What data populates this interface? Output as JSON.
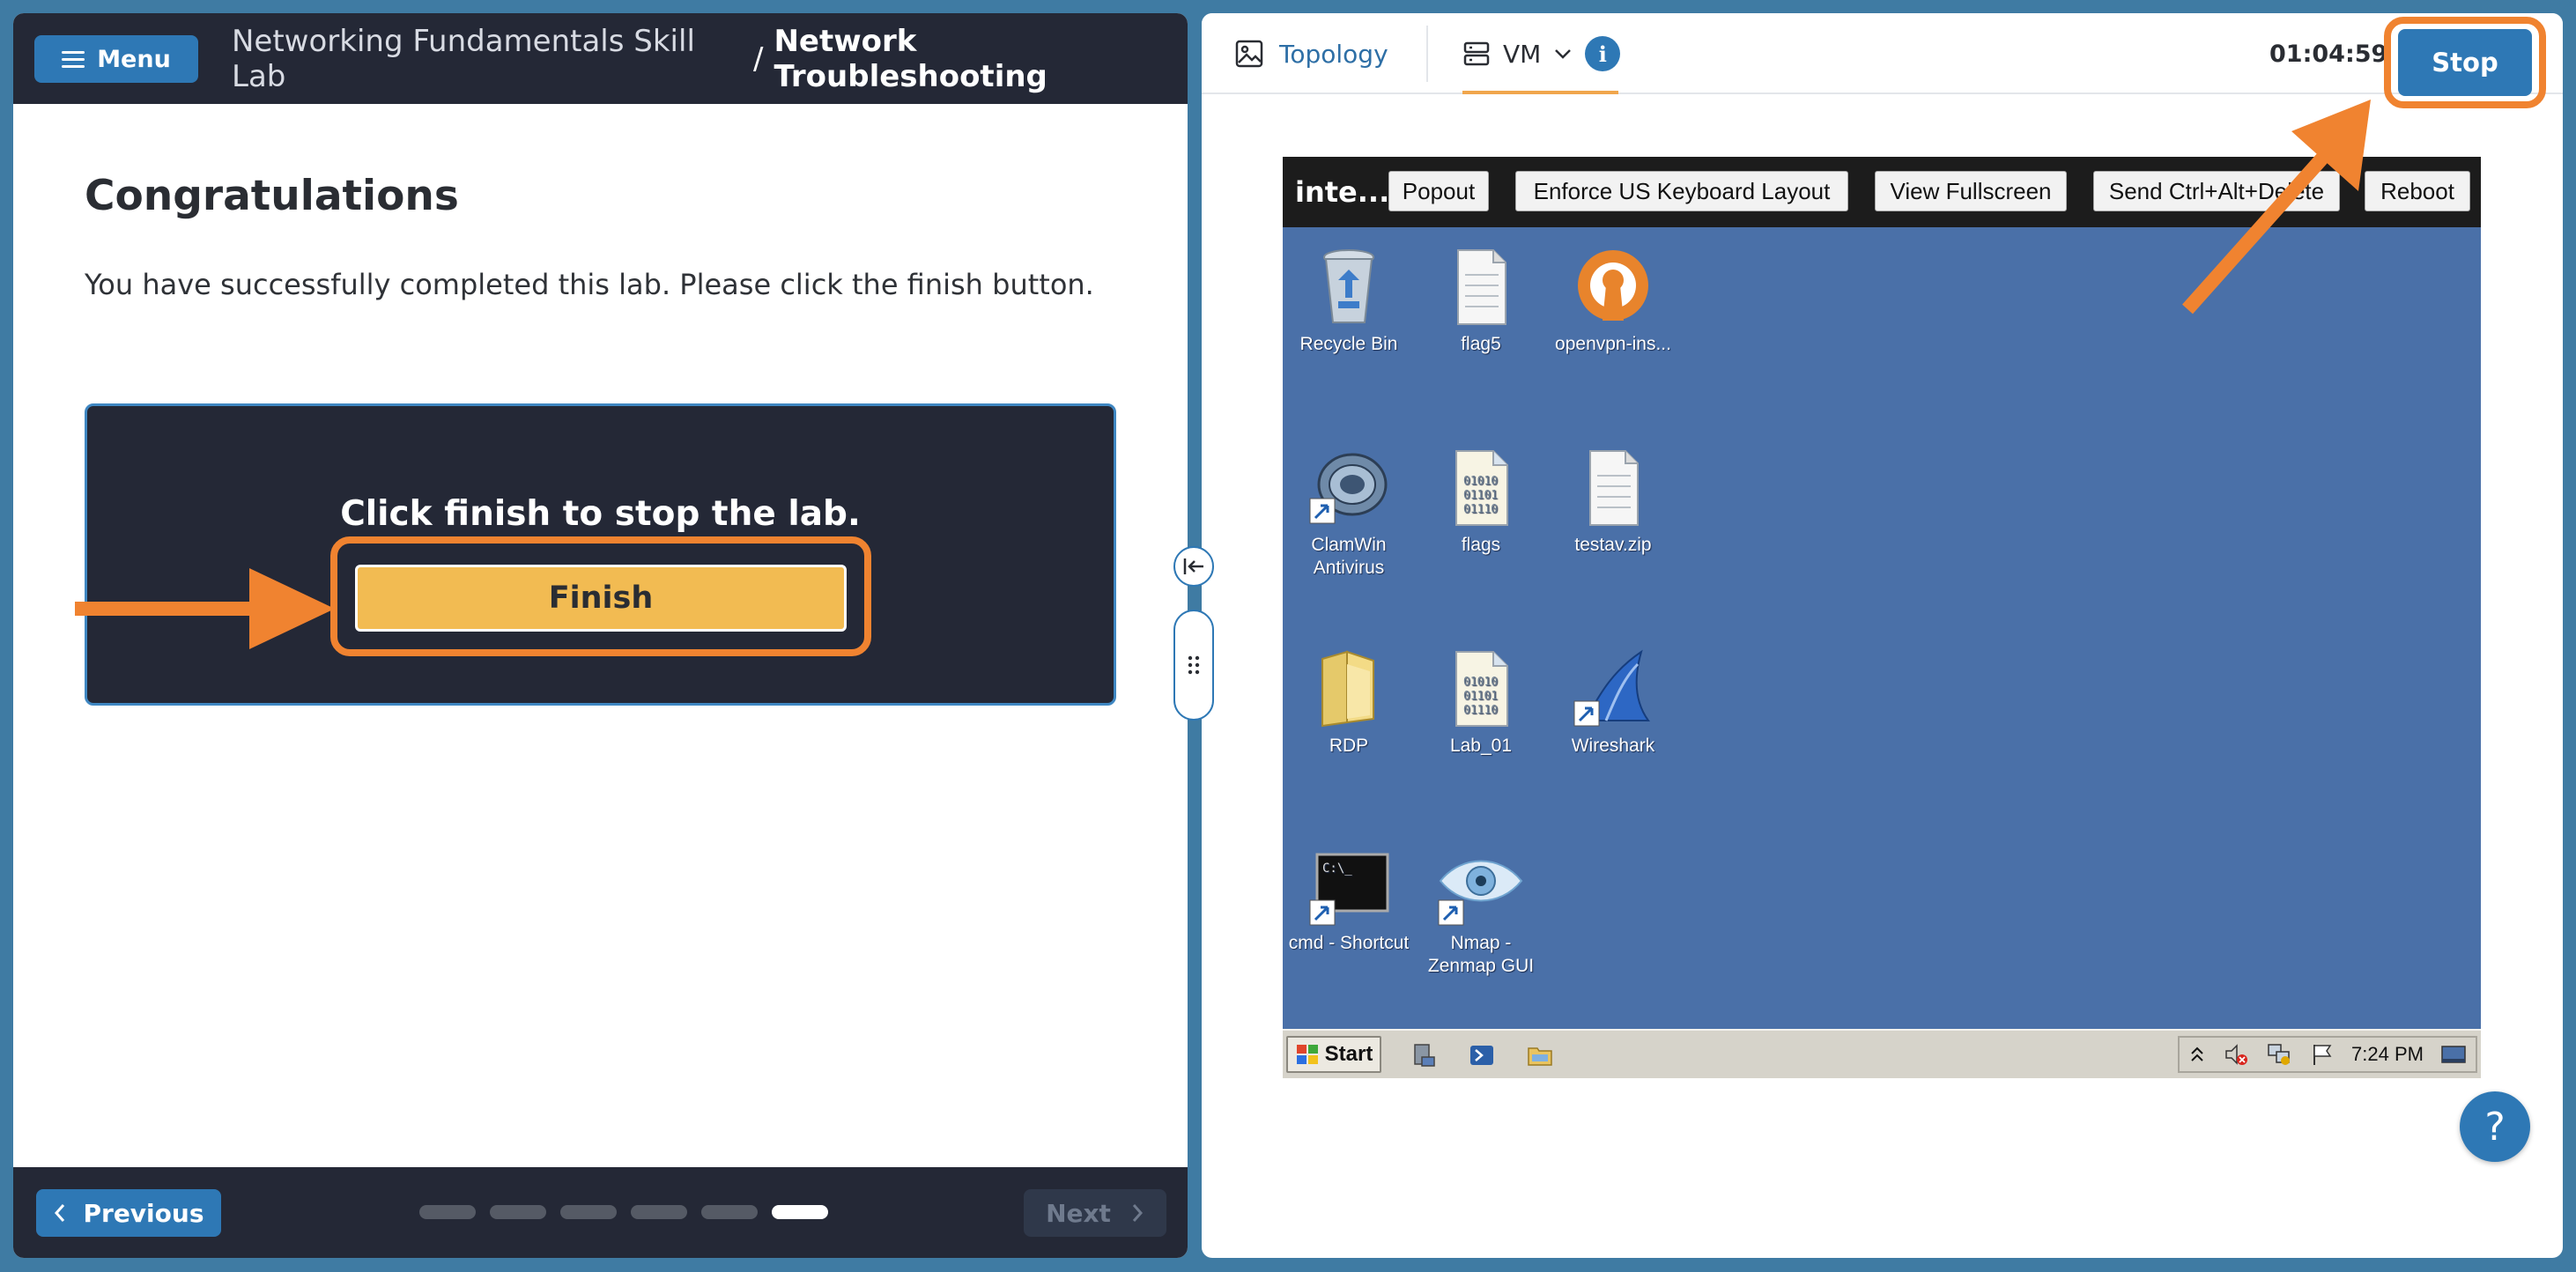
{
  "header": {
    "menu_label": "Menu",
    "course_name": "Networking Fundamentals Skill Lab",
    "separator": "/",
    "lab_name": "Network Troubleshooting"
  },
  "content": {
    "title": "Congratulations",
    "text": "You have successfully completed this lab. Please click the finish button."
  },
  "finish_card": {
    "heading": "Click finish to stop the lab.",
    "finish_label": "Finish"
  },
  "footer": {
    "previous_label": "Previous",
    "next_label": "Next",
    "progress": {
      "total_steps": 6,
      "current_step": 6
    }
  },
  "right_header": {
    "topology_label": "Topology",
    "vm_label": "VM",
    "info_symbol": "i",
    "timer": "01:04:59",
    "stop_label": "Stop"
  },
  "vm": {
    "title": "inte...",
    "toolbar_buttons": [
      "Popout",
      "Enforce US Keyboard Layout",
      "View Fullscreen",
      "Send Ctrl+Alt+Delete",
      "Reboot"
    ],
    "desktop_icons": [
      {
        "label": "Recycle Bin",
        "icon": "recycle-bin-icon"
      },
      {
        "label": "flag5",
        "icon": "text-file-icon"
      },
      {
        "label": "openvpn-ins...",
        "icon": "openvpn-icon"
      },
      {
        "label": "ClamWin Antivirus",
        "icon": "clamwin-icon"
      },
      {
        "label": "flags",
        "icon": "binary-file-icon"
      },
      {
        "label": "testav.zip",
        "icon": "text-file-icon"
      },
      {
        "label": "RDP",
        "icon": "folder-icon"
      },
      {
        "label": "Lab_01",
        "icon": "binary-file-icon"
      },
      {
        "label": "Wireshark",
        "icon": "wireshark-icon"
      },
      {
        "label": "cmd - Shortcut",
        "icon": "cmd-icon"
      },
      {
        "label": "Nmap - Zenmap GUI",
        "icon": "nmap-icon"
      }
    ],
    "taskbar": {
      "start_label": "Start",
      "clock": "7:24 PM"
    }
  },
  "help_symbol": "?",
  "colors": {
    "accent": "#2e78b5",
    "dark": "#242836",
    "highlight": "#f08330",
    "finish": "#f2bb52",
    "desktop": "#4a70a8"
  }
}
